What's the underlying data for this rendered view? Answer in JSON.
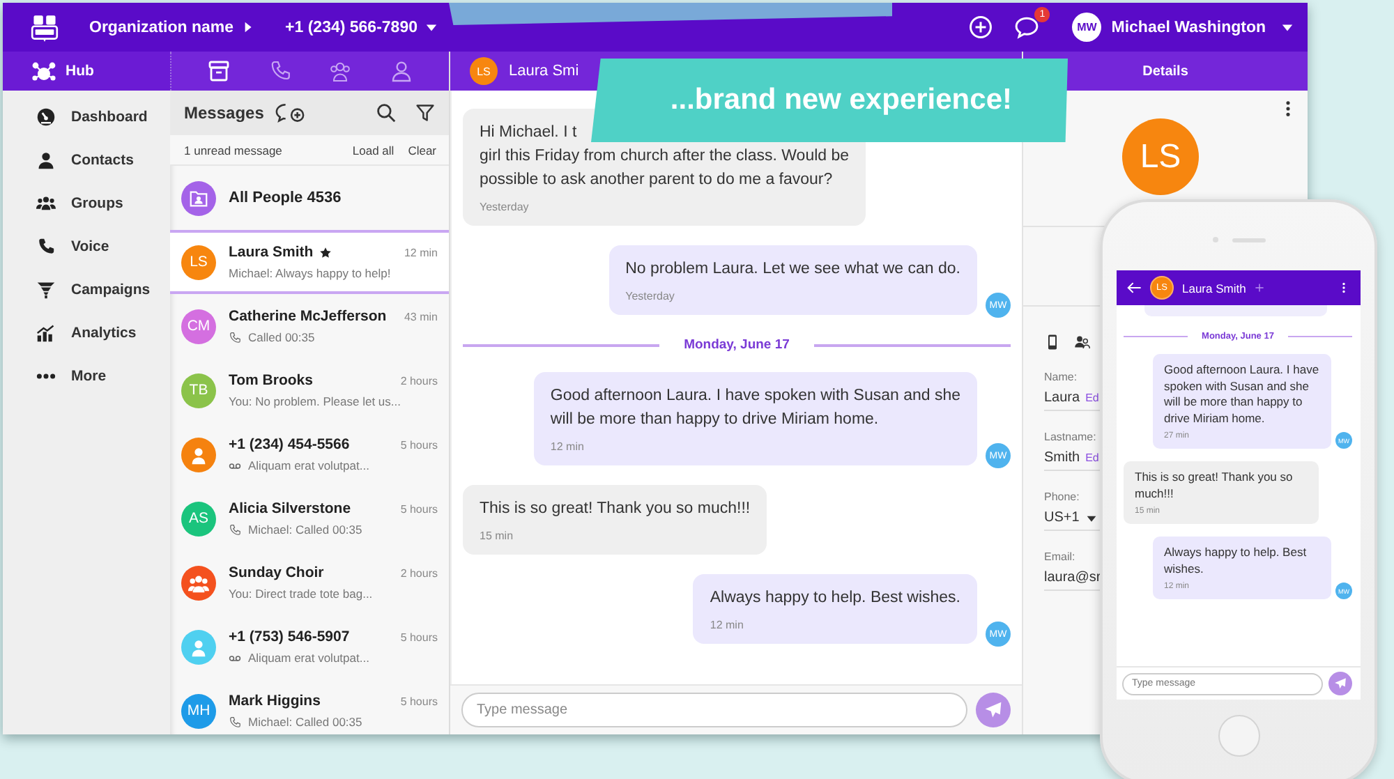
{
  "top_bar": {
    "organization": "Organization name",
    "phone_number": "+1 (234) 566-7890",
    "notification_count": "1",
    "user": {
      "initials": "MW",
      "name": "Michael Washington"
    }
  },
  "sidebar": {
    "header": "Hub",
    "items": [
      {
        "label": "Dashboard"
      },
      {
        "label": "Contacts"
      },
      {
        "label": "Groups"
      },
      {
        "label": "Voice"
      },
      {
        "label": "Campaigns"
      },
      {
        "label": "Analytics"
      },
      {
        "label": "More"
      }
    ]
  },
  "messages_panel": {
    "title": "Messages",
    "unread": "1 unread message",
    "load_all": "Load all",
    "clear": "Clear",
    "all_people": "All People 4536",
    "conversations": [
      {
        "name": "Laura Smith",
        "starred": true,
        "time": "12 min",
        "preview": {
          "kind": "text",
          "text": "Michael: Always happy to help!"
        },
        "avatar": {
          "kind": "initials",
          "initials": "LS",
          "color": "#f7860f"
        },
        "selected": true
      },
      {
        "name": "Catherine McJefferson",
        "starred": false,
        "time": "43 min",
        "preview": {
          "kind": "call",
          "text": "Called 00:35"
        },
        "avatar": {
          "kind": "initials",
          "initials": "CM",
          "color": "#d46fe0"
        },
        "selected": false
      },
      {
        "name": "Tom Brooks",
        "starred": false,
        "time": "2 hours",
        "preview": {
          "kind": "text",
          "text": "You: No problem. Please let us..."
        },
        "avatar": {
          "kind": "initials",
          "initials": "TB",
          "color": "#8bc34a"
        },
        "selected": false
      },
      {
        "name": "+1 (234) 454-5566",
        "starred": false,
        "time": "5 hours",
        "preview": {
          "kind": "voicemail",
          "text": "Aliquam erat volutpat..."
        },
        "avatar": {
          "kind": "person",
          "color": "#f5820f"
        },
        "selected": false
      },
      {
        "name": "Alicia Silverstone",
        "starred": false,
        "time": "5 hours",
        "preview": {
          "kind": "call",
          "text": "Michael: Called 00:35"
        },
        "avatar": {
          "kind": "initials",
          "initials": "AS",
          "color": "#1bc47d"
        },
        "selected": false
      },
      {
        "name": "Sunday Choir",
        "starred": false,
        "time": "2 hours",
        "preview": {
          "kind": "text",
          "text": "You: Direct trade tote bag..."
        },
        "avatar": {
          "kind": "group",
          "color": "#f4511e"
        },
        "selected": false
      },
      {
        "name": "+1 (753) 546-5907",
        "starred": false,
        "time": "5 hours",
        "preview": {
          "kind": "voicemail",
          "text": "Aliquam erat volutpat..."
        },
        "avatar": {
          "kind": "person",
          "color": "#4fd0f0"
        },
        "selected": false
      },
      {
        "name": "Mark Higgins",
        "starred": false,
        "time": "5 hours",
        "preview": {
          "kind": "call",
          "text": "Michael: Called 00:35"
        },
        "avatar": {
          "kind": "initials",
          "initials": "MH",
          "color": "#1e9be8"
        },
        "selected": false
      }
    ]
  },
  "chat": {
    "contact": {
      "initials": "LS",
      "name": "Laura Smi"
    },
    "messages": [
      {
        "kind": "incoming",
        "lines": [
          "Hi Michael. I t",
          "girl this Friday from church after the class. Would be",
          "possible to ask another parent to do me a favour?"
        ],
        "time": "Yesterday"
      },
      {
        "kind": "outgoing",
        "lines": [
          "No problem Laura. Let we see what we can do."
        ],
        "time": "Yesterday",
        "avatar": "MW"
      },
      {
        "kind": "divider",
        "text": "Monday, June 17"
      },
      {
        "kind": "outgoing",
        "lines": [
          "Good afternoon Laura. I have spoken with Susan and she",
          "will be more than happy to drive Miriam home."
        ],
        "time": "12 min",
        "avatar": "MW"
      },
      {
        "kind": "incoming",
        "lines": [
          "This is so great! Thank you so much!!!"
        ],
        "time": "15 min"
      },
      {
        "kind": "outgoing",
        "lines": [
          "Always happy to help. Best wishes."
        ],
        "time": "12 min",
        "avatar": "MW"
      }
    ],
    "input": {
      "placeholder": "Type message"
    }
  },
  "details": {
    "title": "Details",
    "avatar": "LS",
    "fields": [
      {
        "kind": "text",
        "label": "Name:",
        "value": "Laura",
        "action": "Ed"
      },
      {
        "kind": "text",
        "label": "Lastname:",
        "value": "Smith",
        "action": "Ed"
      },
      {
        "kind": "dropdown",
        "label": "Phone:",
        "value": "US+1"
      },
      {
        "kind": "text",
        "label": "Email:",
        "value": "laura@sr"
      }
    ]
  },
  "banner": {
    "text": "...brand new experience!"
  },
  "phone": {
    "contact": {
      "initials": "LS",
      "name": "Laura Smith"
    },
    "messages": [
      {
        "kind": "divider",
        "text": "Monday, June 17"
      },
      {
        "kind": "outgoing",
        "text": "Good afternoon Laura. I have spoken with Susan and she will be more than happy to drive Miriam home.",
        "time": "27 min",
        "avatar": "MW"
      },
      {
        "kind": "incoming",
        "text": "This is so great! Thank you so much!!!",
        "time": "15 min"
      },
      {
        "kind": "outgoing",
        "text": "Always happy to help. Best wishes.",
        "time": "12 min",
        "avatar": "MW"
      }
    ],
    "input": {
      "placeholder": "Type message"
    }
  }
}
